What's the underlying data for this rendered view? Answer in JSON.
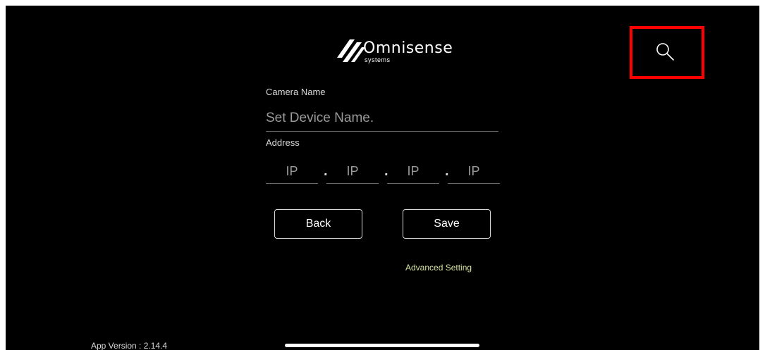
{
  "logo": {
    "name": "Omnisense",
    "subtitle": "systems"
  },
  "form": {
    "camera_name_label": "Camera Name",
    "camera_name_placeholder": "Set Device Name.",
    "camera_name_value": "",
    "address_label": "Address",
    "ip_fields": [
      {
        "placeholder": "IP",
        "value": ""
      },
      {
        "placeholder": "IP",
        "value": ""
      },
      {
        "placeholder": "IP",
        "value": ""
      },
      {
        "placeholder": "IP",
        "value": ""
      }
    ],
    "separator": "."
  },
  "buttons": {
    "back_label": "Back",
    "save_label": "Save"
  },
  "advanced_setting_label": "Advanced Setting",
  "app_version_text": "App Version : 2.14.4",
  "icons": {
    "search": "search-icon",
    "logo": "omnisense-logo-icon"
  },
  "colors": {
    "background": "#000000",
    "highlight": "#ff0000",
    "advanced_link": "#d6e3a0"
  }
}
